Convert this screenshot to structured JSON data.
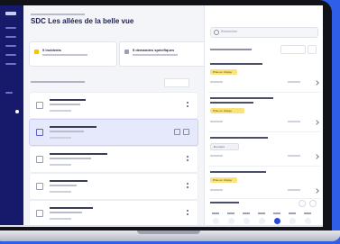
{
  "page": {
    "title": "SDC Les allées de la belle vue"
  },
  "stats": [
    {
      "label": "9 incidents",
      "color": "#f5c400"
    },
    {
      "label": "5 demandes spécifiques",
      "color": "#9aa0b4"
    }
  ],
  "panel": {
    "search_placeholder": "Rechercher",
    "tasks": [
      {
        "tag": "Prise en charge"
      },
      {
        "tag": "Prise en charge"
      },
      {
        "tag": "En cours"
      },
      {
        "tag": "Prise en charge"
      }
    ]
  },
  "colors": {
    "nav_bg": "#17196a",
    "accent": "#2b49d6",
    "background": "#2f5fe8",
    "tag_yellow": "#fbe27a"
  }
}
